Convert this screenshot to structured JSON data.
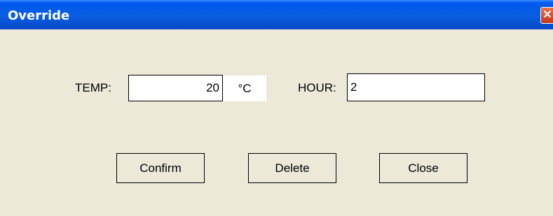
{
  "window": {
    "title": "Override",
    "close_glyph": "✕"
  },
  "form": {
    "temp_label": "TEMP:",
    "temp_value": "20",
    "temp_unit": "°C",
    "hour_label": "HOUR:",
    "hour_value": "2"
  },
  "buttons": {
    "confirm": "Confirm",
    "delete": "Delete",
    "close": "Close"
  },
  "colors": {
    "titlebar": "#0a5ee0",
    "client": "#ece9d8",
    "close_button": "#d6512e"
  }
}
